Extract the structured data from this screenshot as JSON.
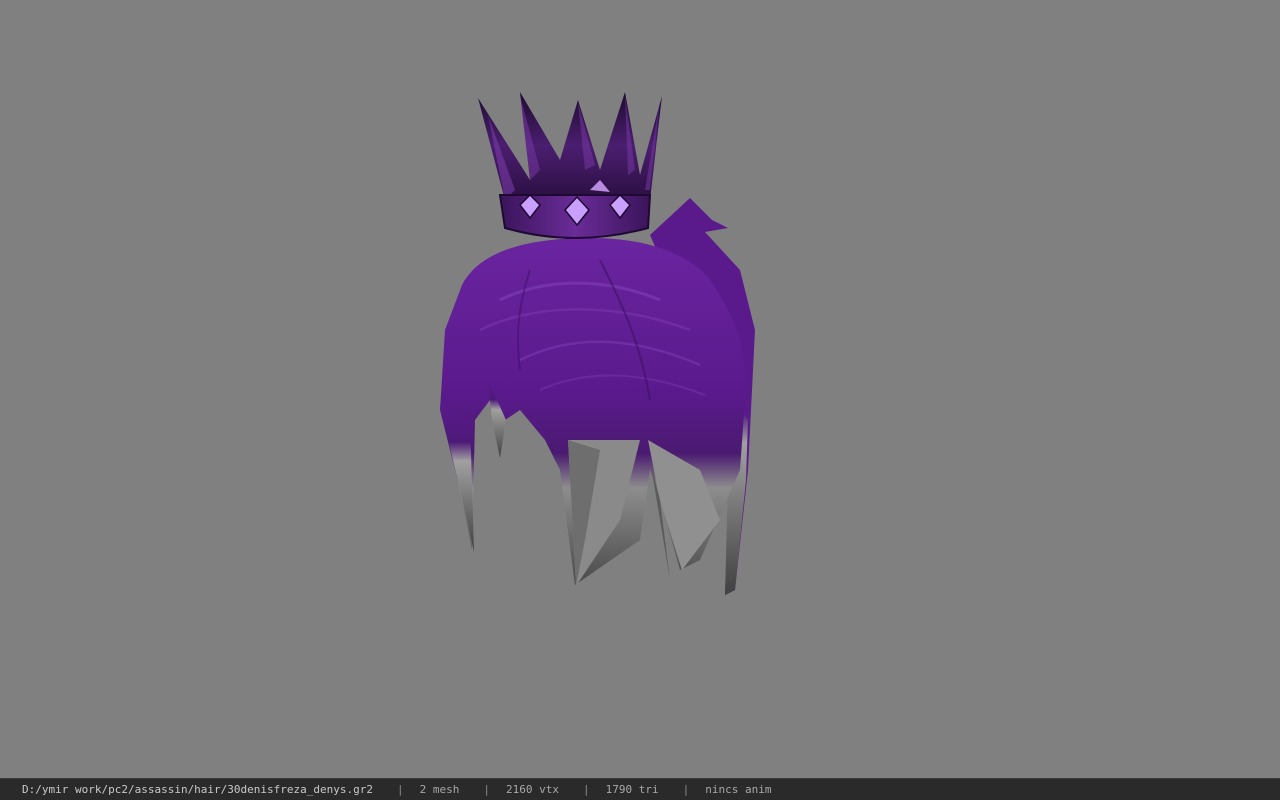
{
  "viewer": {
    "background_color": "#808080",
    "model": {
      "description_icon": "hair-with-crown-model",
      "hair_color": "#5b1b8c",
      "hair_tip_color": "#9a9a9a",
      "crown_color": "#3a1658"
    }
  },
  "status_bar": {
    "file_path": "D:/ymir work/pc2/assassin/hair/30denisfreza_denys.gr2",
    "separator": "|",
    "mesh_count": "2 mesh",
    "vertex_count": "2160 vtx",
    "triangle_count": "1790 tri",
    "animation": "nincs anim"
  }
}
